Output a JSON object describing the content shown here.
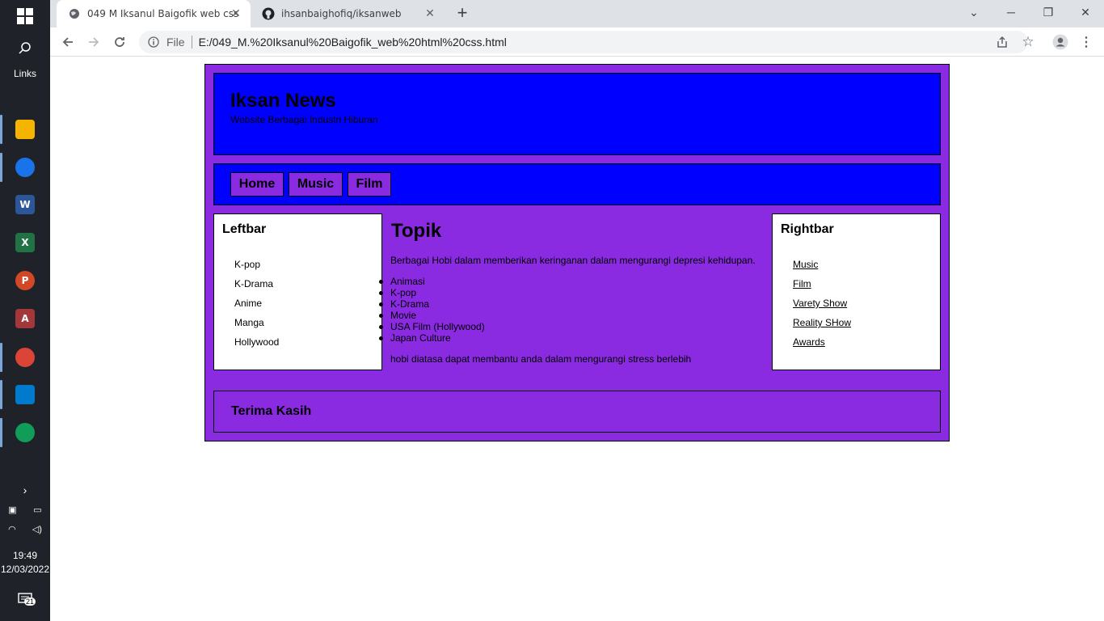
{
  "taskbar": {
    "links_label": "Links",
    "apps": [
      "file-explorer",
      "chrome-profile-1",
      "word",
      "excel",
      "powerpoint",
      "access",
      "chrome-profile-2",
      "vscode",
      "chrome"
    ],
    "clock_time": "19:49",
    "clock_date": "12/03/2022",
    "notification_count": "21"
  },
  "browser": {
    "tabs": [
      {
        "title": "049 M Iksanul Baigofik web css",
        "active": true
      },
      {
        "title": "ihsanbaighofiq/iksanweb",
        "active": false
      }
    ],
    "address": {
      "label": "File",
      "url": "E:/049_M.%20Iksanul%20Baigofik_web%20html%20css.html"
    }
  },
  "site": {
    "title": "Iksan News",
    "subtitle": "Website Berbagai Industri Hiburan",
    "nav": [
      "Home",
      "Music",
      "Film"
    ],
    "leftbar": {
      "title": "Leftbar",
      "items": [
        "K-pop",
        "K-Drama",
        "Anime",
        "Manga",
        "Hollywood"
      ]
    },
    "main": {
      "heading": "Topik",
      "intro": "Berbagai Hobi dalam memberikan keringanan dalam mengurangi depresi kehidupan.",
      "list": [
        "Animasi",
        "K-pop",
        "K-Drama",
        "Movie",
        "USA Film (Hollywood)",
        "Japan Culture"
      ],
      "outro": "hobi diatasa dapat membantu anda dalam mengurangi stress berlebih"
    },
    "rightbar": {
      "title": "Rightbar",
      "links": [
        "Music",
        "Film",
        "Varety Show",
        "Reality SHow",
        "Awards"
      ]
    },
    "footer": "Terima Kasih"
  },
  "colors": {
    "purple": "#8a2be2",
    "blue": "#0000ff"
  }
}
